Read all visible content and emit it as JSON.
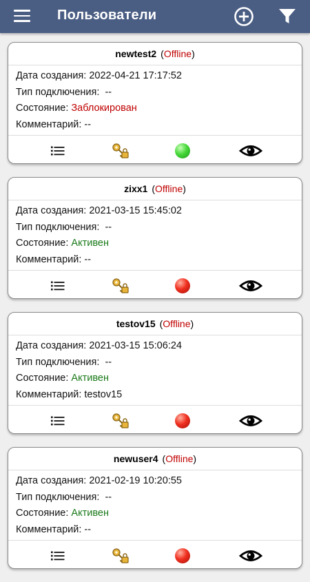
{
  "appbar": {
    "title": "Пользователи",
    "icons": {
      "menu": "hamburger-menu-icon",
      "add": "add-circle-icon",
      "filter": "filter-icon"
    }
  },
  "colors": {
    "appbar": "#4a5d83",
    "offline": "#c00000",
    "blocked": "#c00000",
    "active": "#1a7a1a"
  },
  "labels": {
    "created": "Дата создания:",
    "connection": "Тип подключения:",
    "state": "Состояние:",
    "comment": "Комментарий:"
  },
  "users": [
    {
      "name": "newtest2",
      "status_open": "(",
      "status": "Offline",
      "status_close": ")",
      "created": "2022-04-21 17:17:52",
      "connection": "--",
      "state": "Заблокирован",
      "state_kind": "blocked",
      "comment": "--",
      "indicator": "green"
    },
    {
      "name": "zixx1",
      "status_open": "(",
      "status": "Offline",
      "status_close": ")",
      "created": "2021-03-15 15:45:02",
      "connection": "--",
      "state": "Активен",
      "state_kind": "active",
      "comment": "--",
      "indicator": "red"
    },
    {
      "name": "testov15",
      "status_open": "(",
      "status": "Offline",
      "status_close": ")",
      "created": "2021-03-15 15:06:24",
      "connection": "--",
      "state": "Активен",
      "state_kind": "active",
      "comment": "testov15",
      "indicator": "red"
    },
    {
      "name": "newuser4",
      "status_open": "(",
      "status": "Offline",
      "status_close": ")",
      "created": "2021-02-19 10:20:55",
      "connection": "--",
      "state": "Активен",
      "state_kind": "active",
      "comment": "--",
      "indicator": "red"
    }
  ],
  "actions": {
    "list": "list-icon",
    "key": "key-lock-icon",
    "status": "status-indicator-icon",
    "view": "eye-icon"
  }
}
